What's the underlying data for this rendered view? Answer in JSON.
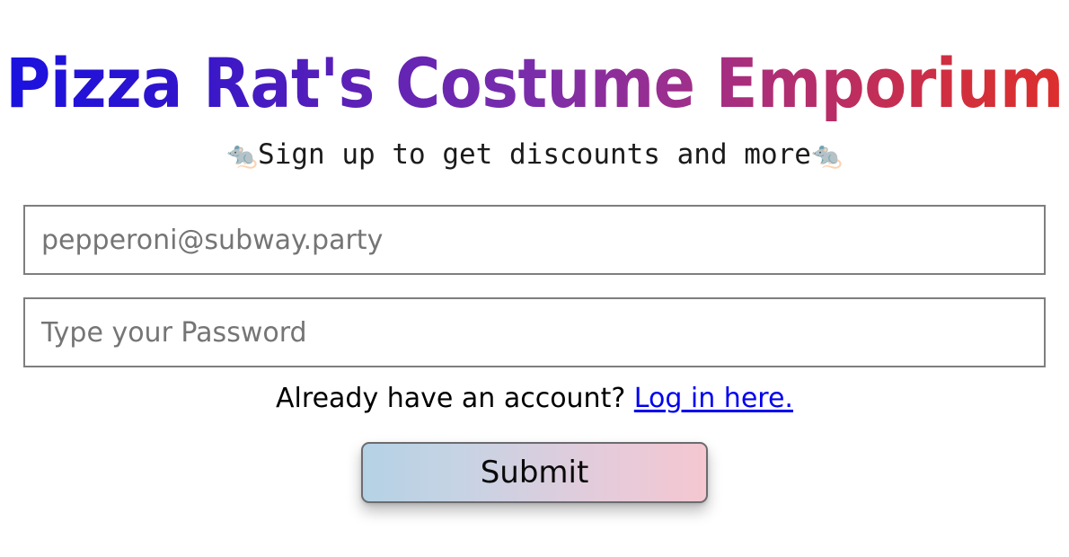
{
  "page": {
    "background_color": "#ffffff"
  },
  "header": {
    "title": "Pizza Rat's Costume Emporium",
    "title_gradient_start": "#1a12e0",
    "title_gradient_mid": "#7b2daa",
    "title_gradient_end": "#dd2f2c",
    "subtitle_icon_left": "🐀",
    "subtitle_text": "Sign up to get discounts and more",
    "subtitle_icon_right": "🐀"
  },
  "form": {
    "email": {
      "placeholder": "pepperoni@subway.party",
      "value": "",
      "type": "email"
    },
    "password": {
      "placeholder": "Type your Password",
      "value": "",
      "type": "password"
    },
    "login_prompt": "Already have an account? ",
    "login_link_label": "Log in here.",
    "login_link_color": "#0000ee",
    "submit_label": "Submit",
    "submit_gradient_start": "#b5d2e5",
    "submit_gradient_end": "#f4c7d1"
  }
}
